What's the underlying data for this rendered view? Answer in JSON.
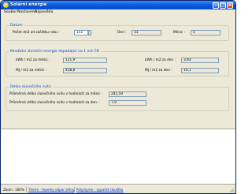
{
  "window": {
    "title": "Solární energie",
    "minimize_glyph": "–",
    "maximize_glyph": "□",
    "close_glyph": "×"
  },
  "menu": {
    "items": [
      {
        "label": "Soubor"
      },
      {
        "label": "Nastavení"
      },
      {
        "label": "Nápověda"
      }
    ]
  },
  "datum": {
    "title": "Datum",
    "day_of_year_label": "Počet dnů od začátku roku :",
    "day_of_year_value": "151",
    "day_label": "Den :",
    "day_value": "31",
    "month_label": "Měsíc :",
    "month_value": "5"
  },
  "energy": {
    "title": "Množství sluneční energie dopadající na 1 m2 ČR",
    "kwh_month_label": "kWh / m2 za měsíc :",
    "kwh_month_value": "121,9",
    "kwh_day_label": "kWh / m2 za den :",
    "kwh_day_value": "3,93",
    "mj_month_label": "MJ / m2 za měsíc :",
    "mj_month_value": "438,8",
    "mj_day_label": "MJ / m2 za den :",
    "mj_day_value": "14,1"
  },
  "sunshine": {
    "title": "Délka slunečního svitu",
    "monthly_label": "Průměrná délka slunečního svitu v hodinách za měsíc :",
    "monthly_value": "245,59",
    "daily_label": "Průměrná délka slunečního svitu v hodinách za den :",
    "daily_value": "7,9"
  },
  "status": {
    "zoom_label": "Zoom :",
    "zoom_value": "100%",
    "link1": "Therm - tepelný odpor stěny",
    "link2": "Polystyren - vypočet tloušťku"
  },
  "colors": {
    "titlebar": "#0a5fe0",
    "group_title": "#0046d5",
    "window_bg": "#ece9d8",
    "link": "#0033cc"
  },
  "icons": {
    "app": "sun-icon",
    "spin_up": "arrow-up-icon",
    "spin_down": "arrow-down-icon",
    "grip": "resize-grip-icon"
  }
}
